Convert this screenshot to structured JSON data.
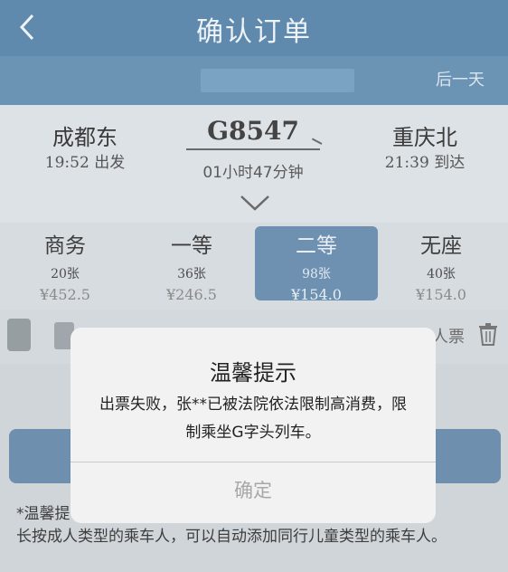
{
  "header": {
    "title": "确认订单",
    "back_icon": "chevron-left-icon"
  },
  "date_bar": {
    "next_day_label": "后一天"
  },
  "train": {
    "from_station": "成都东",
    "from_time": "19:52 出发",
    "train_number": "G8547",
    "duration": "01小时47分钟",
    "to_station": "重庆北",
    "to_time": "21:39 到达",
    "expand_icon": "chevron-down-icon"
  },
  "seats": [
    {
      "name": "商务",
      "count": "20张",
      "price": "¥452.5",
      "selected": false
    },
    {
      "name": "一等",
      "count": "36张",
      "price": "¥246.5",
      "selected": false
    },
    {
      "name": "二等",
      "count": "98张",
      "price": "¥154.0",
      "selected": true
    },
    {
      "name": "无座",
      "count": "40张",
      "price": "¥154.0",
      "selected": false
    }
  ],
  "passenger": {
    "ticket_type": "人票",
    "delete_icon": "trash-icon"
  },
  "tip": {
    "label": "*温馨提",
    "body": "长按成人类型的乘车人，可以自动添加同行儿童类型的乘车人。"
  },
  "modal": {
    "title": "温馨提示",
    "message": "出票失败，张**已被法院依法限制高消费，限制乘坐G字头列车。",
    "ok_label": "确定"
  },
  "colors": {
    "header_bg": "#5f8aae",
    "selected_seat_bg": "#6e91b2",
    "modal_bg": "#f2f2f2"
  }
}
